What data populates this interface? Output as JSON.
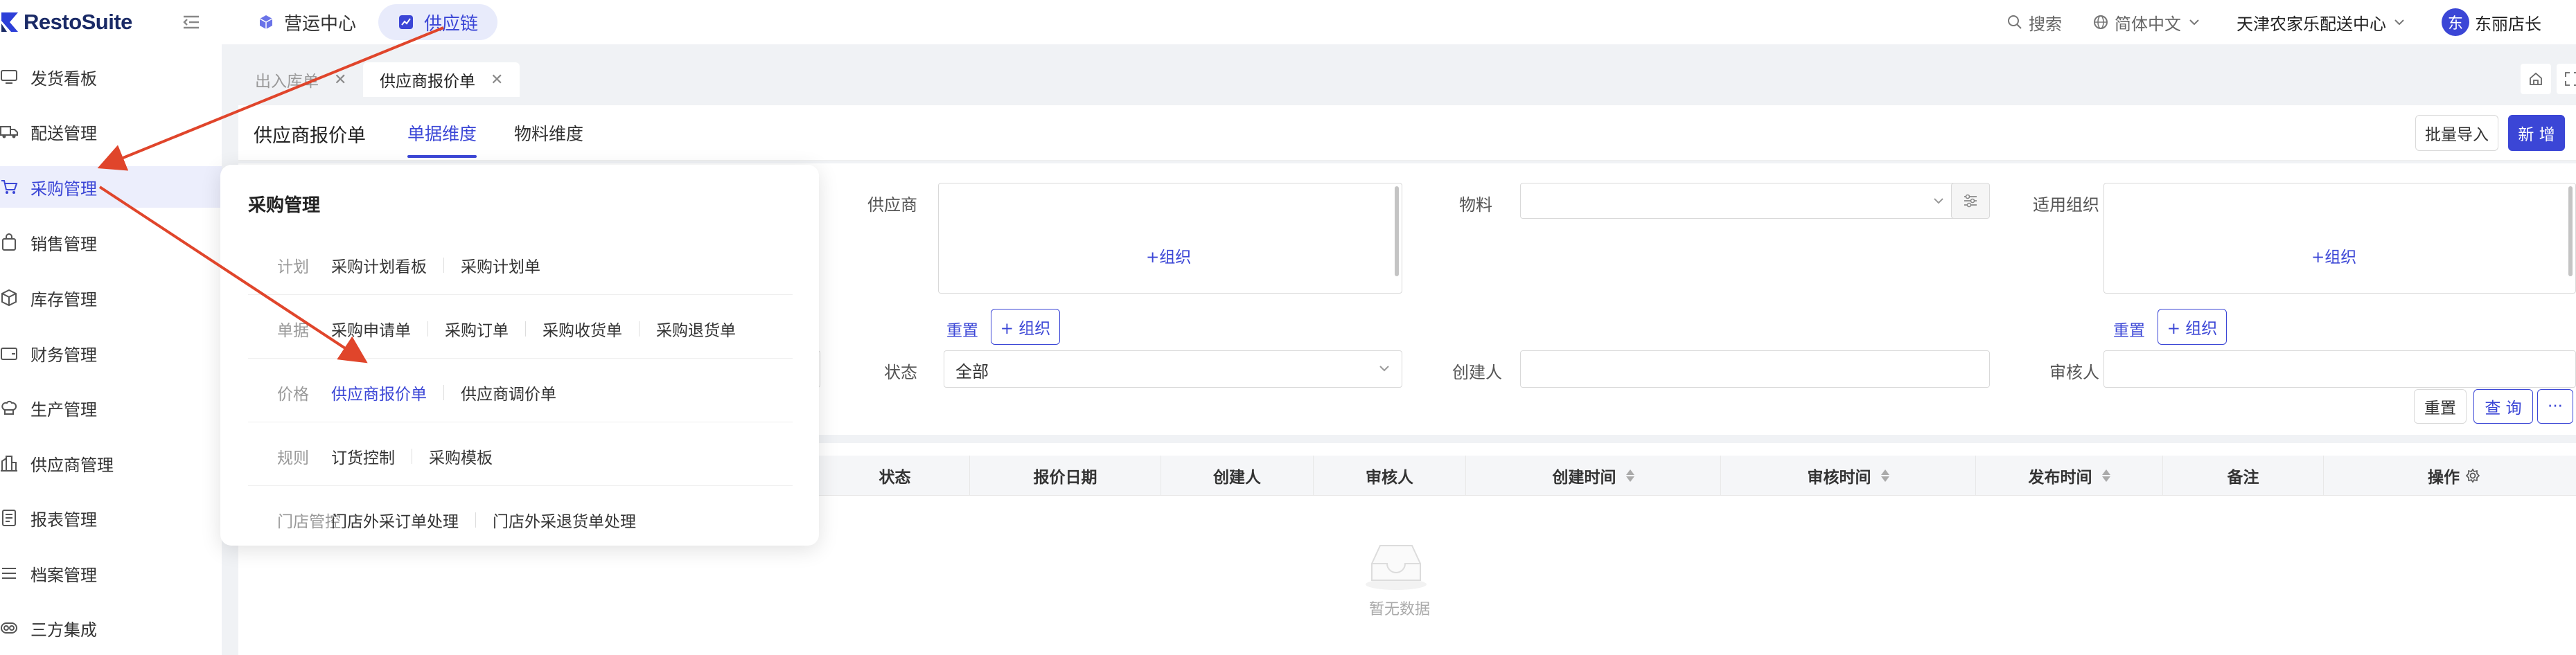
{
  "brand": {
    "name": "RestoSuite"
  },
  "topnav": [
    {
      "label": "营运中心",
      "active": false
    },
    {
      "label": "供应链",
      "active": true
    }
  ],
  "topright": {
    "search": "搜索",
    "language": "简体中文",
    "org": "天津农家乐配送中心",
    "avatar_char": "东",
    "user": "东丽店长"
  },
  "sidebar": {
    "items": [
      {
        "label": "发货看板",
        "icon": "monitor-icon"
      },
      {
        "label": "配送管理",
        "icon": "truck-icon"
      },
      {
        "label": "采购管理",
        "icon": "cart-icon",
        "active": true
      },
      {
        "label": "销售管理",
        "icon": "bag-icon"
      },
      {
        "label": "库存管理",
        "icon": "box-icon"
      },
      {
        "label": "财务管理",
        "icon": "wallet-icon"
      },
      {
        "label": "生产管理",
        "icon": "chef-hat-icon"
      },
      {
        "label": "供应商管理",
        "icon": "building-icon"
      },
      {
        "label": "报表管理",
        "icon": "report-icon"
      },
      {
        "label": "档案管理",
        "icon": "list-icon"
      },
      {
        "label": "三方集成",
        "icon": "integration-icon"
      }
    ]
  },
  "tabs": [
    {
      "label": "出入库单",
      "active": false
    },
    {
      "label": "供应商报价单",
      "active": true
    }
  ],
  "page": {
    "title": "供应商报价单",
    "subtabs": [
      {
        "label": "单据维度",
        "active": true
      },
      {
        "label": "物料维度",
        "active": false
      }
    ],
    "import_label": "批量导入",
    "new_label": "新 增"
  },
  "filters": {
    "supplier_label": "供应商",
    "material_label": "物料",
    "org_label": "适用组织",
    "add_org": "+组织",
    "reset": "重置",
    "add_org_btn": "+ 组织",
    "status_label": "状态",
    "status_value": "全部",
    "creator_label": "创建人",
    "reviewer_label": "审核人",
    "reset_btn": "重置",
    "query_btn": "查 询",
    "more_btn": "···"
  },
  "table": {
    "columns": [
      "状态",
      "报价日期",
      "创建人",
      "审核人",
      "创建时间",
      "审核时间",
      "发布时间",
      "备注",
      "操作"
    ],
    "empty_text": "暂无数据"
  },
  "dropdown": {
    "title": "采购管理",
    "rows": [
      {
        "category": "计划",
        "links": [
          "采购计划看板",
          "采购计划单"
        ]
      },
      {
        "category": "单据",
        "links": [
          "采购申请单",
          "采购订单",
          "采购收货单",
          "采购退货单"
        ]
      },
      {
        "category": "价格",
        "links": [
          "供应商报价单",
          "供应商调价单"
        ],
        "active": "供应商报价单"
      },
      {
        "category": "规则",
        "links": [
          "订货控制",
          "采购模板"
        ]
      },
      {
        "category": "门店管控",
        "links": [
          "门店外采订单处理",
          "门店外采退货单处理"
        ]
      }
    ]
  },
  "colors": {
    "accent": "#3b46d6",
    "annotation": "#e0452b"
  }
}
